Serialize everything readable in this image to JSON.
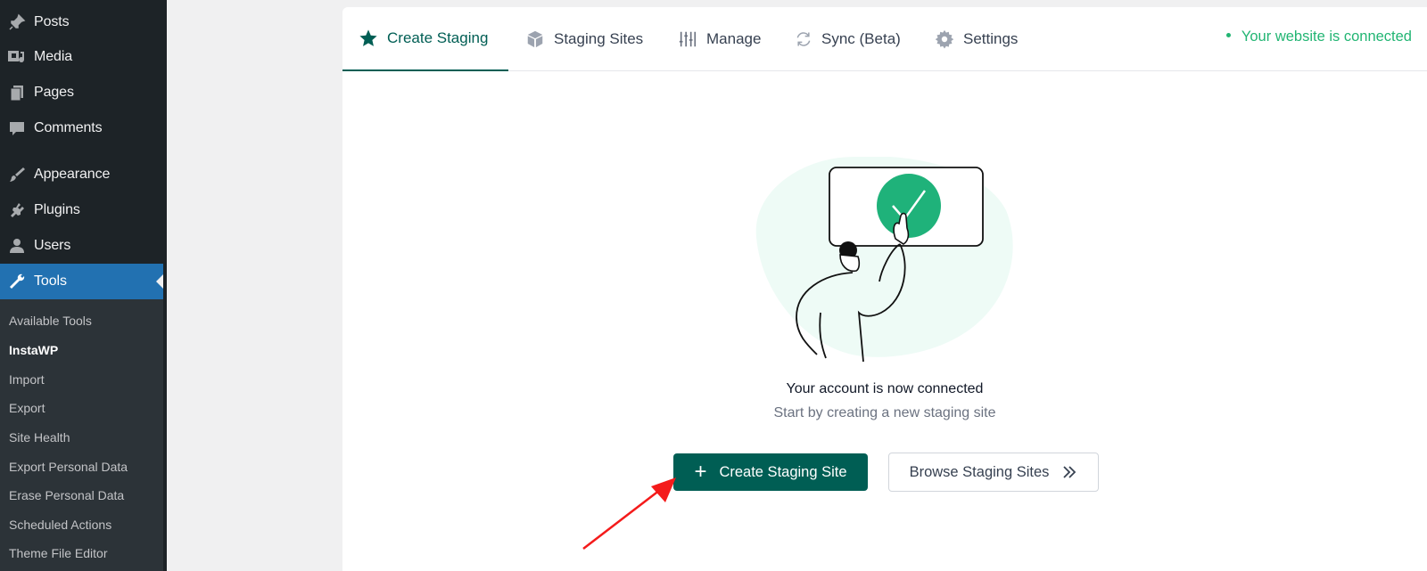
{
  "sidebar": {
    "menu": [
      {
        "label": "Posts",
        "icon": "pin-icon"
      },
      {
        "label": "Media",
        "icon": "media-icon"
      },
      {
        "label": "Pages",
        "icon": "pages-icon"
      },
      {
        "label": "Comments",
        "icon": "comment-icon"
      },
      {
        "label": "Appearance",
        "icon": "brush-icon"
      },
      {
        "label": "Plugins",
        "icon": "plug-icon"
      },
      {
        "label": "Users",
        "icon": "user-icon"
      },
      {
        "label": "Tools",
        "icon": "wrench-icon"
      }
    ],
    "submenu": [
      "Available Tools",
      "InstaWP",
      "Import",
      "Export",
      "Site Health",
      "Export Personal Data",
      "Erase Personal Data",
      "Scheduled Actions",
      "Theme File Editor"
    ]
  },
  "tabs": [
    {
      "label": "Create Staging",
      "icon": "star-icon"
    },
    {
      "label": "Staging Sites",
      "icon": "box-icon"
    },
    {
      "label": "Manage",
      "icon": "sliders-icon"
    },
    {
      "label": "Sync (Beta)",
      "icon": "sync-icon"
    },
    {
      "label": "Settings",
      "icon": "gear-icon"
    }
  ],
  "status": "Your website is connected",
  "main": {
    "heading": "Your account is now connected",
    "subheading": "Start by creating a new staging site",
    "primary_button": "Create Staging Site",
    "secondary_button": "Browse Staging Sites"
  },
  "colors": {
    "accent": "#005e54",
    "success": "#22b573",
    "sidebar": "#1d2327",
    "active_menu": "#2271b1"
  }
}
